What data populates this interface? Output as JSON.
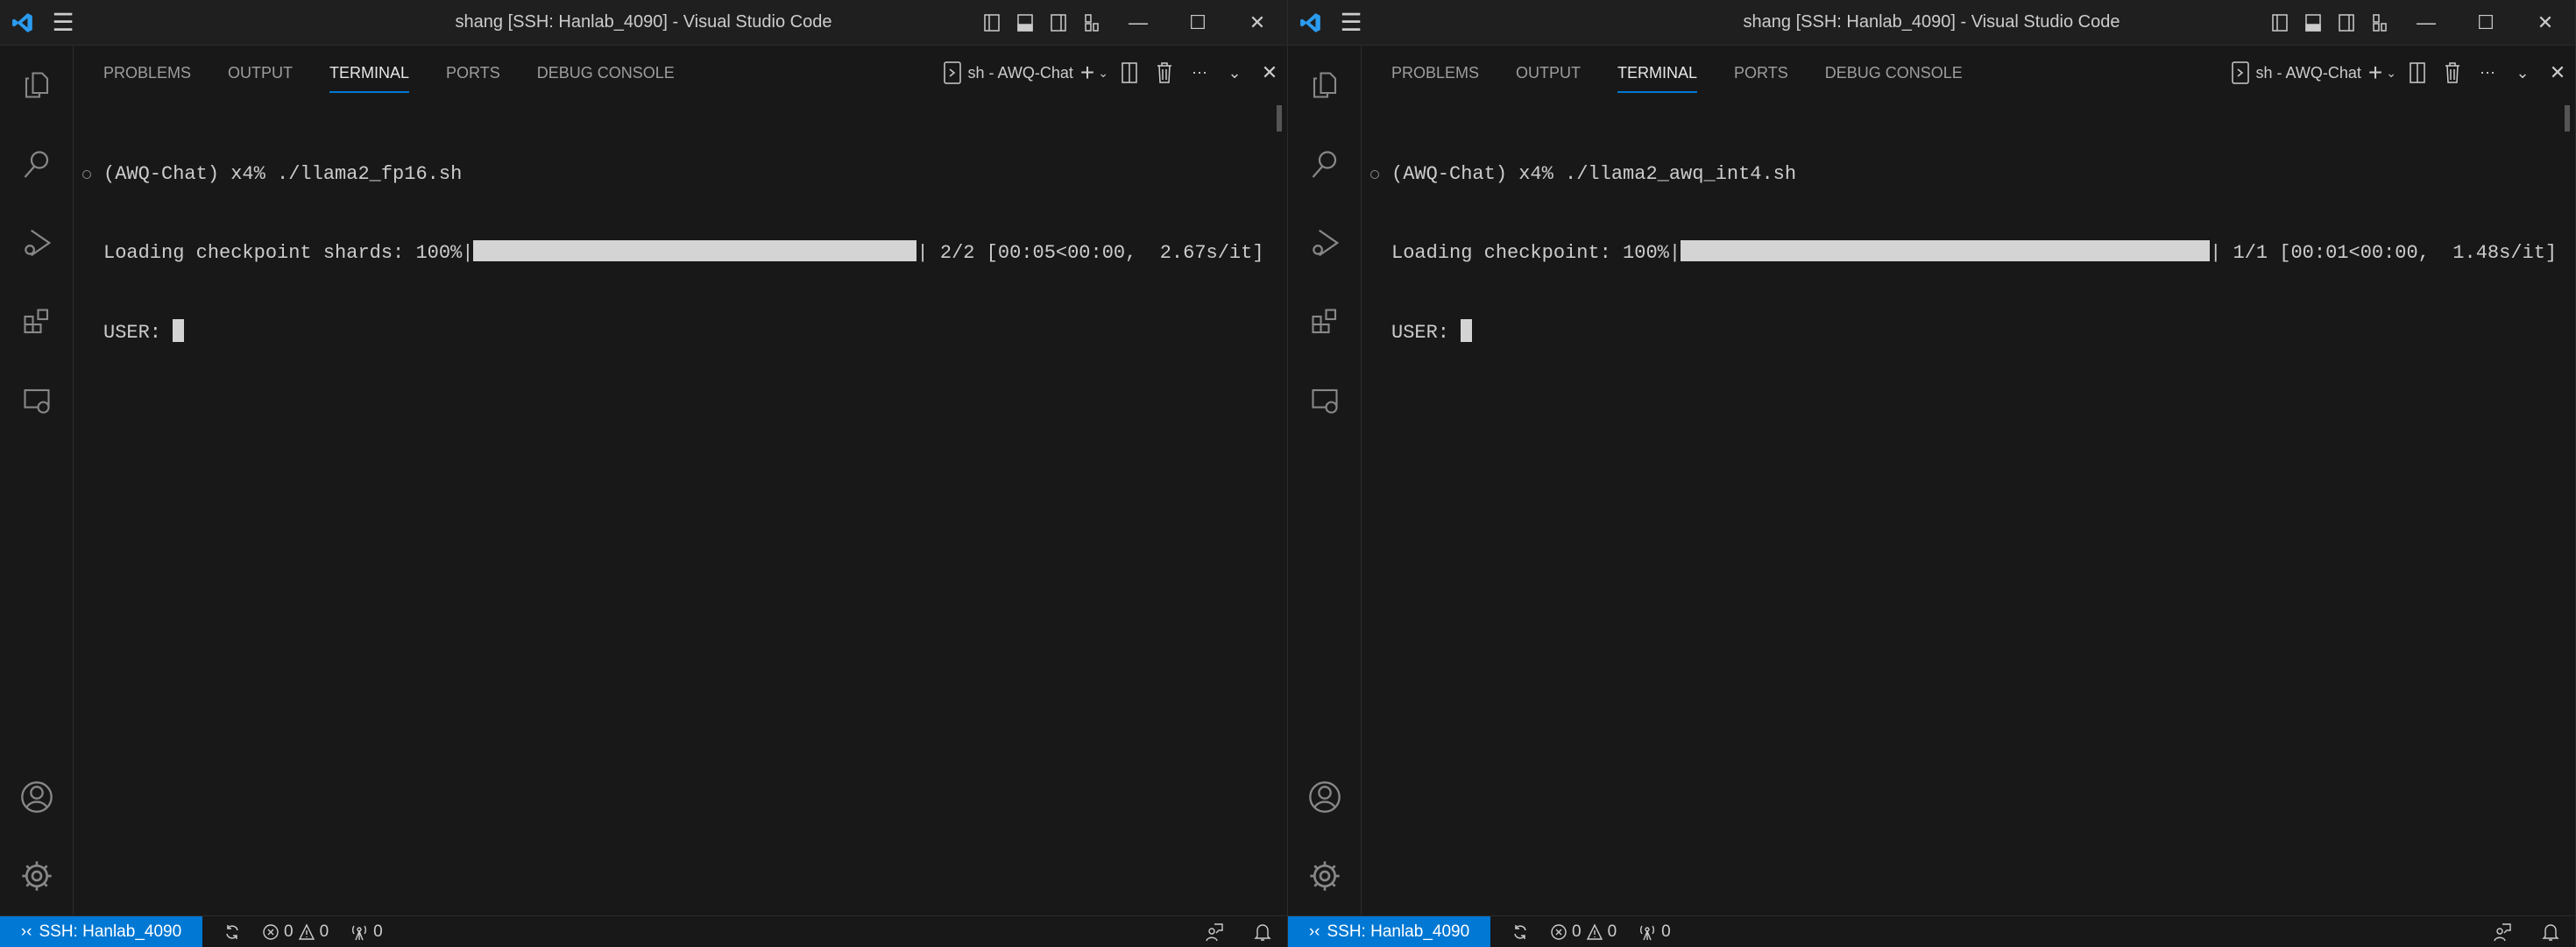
{
  "windows": [
    {
      "title": "shang [SSH: Hanlab_4090] - Visual Studio Code",
      "tabs": [
        "PROBLEMS",
        "OUTPUT",
        "TERMINAL",
        "PORTS",
        "DEBUG CONSOLE"
      ],
      "active_tab": "TERMINAL",
      "terminal_name": "sh - AWQ-Chat",
      "terminal": {
        "command": "(AWQ-Chat) x4% ./llama2_fp16.sh",
        "progress_prefix": "Loading checkpoint shards: 100%|",
        "progress_percent": 100,
        "progress_suffix": "| 2/2 [00:05<00:00,  2.67s/it]",
        "prompt": "USER: "
      },
      "status": {
        "remote": "SSH: Hanlab_4090",
        "errors": "0",
        "warnings": "0",
        "ports": "0"
      }
    },
    {
      "title": "shang [SSH: Hanlab_4090] - Visual Studio Code",
      "tabs": [
        "PROBLEMS",
        "OUTPUT",
        "TERMINAL",
        "PORTS",
        "DEBUG CONSOLE"
      ],
      "active_tab": "TERMINAL",
      "terminal_name": "sh - AWQ-Chat",
      "terminal": {
        "command": "(AWQ-Chat) x4% ./llama2_awq_int4.sh",
        "progress_prefix": "Loading checkpoint: 100%|",
        "progress_percent": 100,
        "progress_suffix": "| 1/1 [00:01<00:00,  1.48s/it]",
        "prompt": "USER: "
      },
      "status": {
        "remote": "SSH: Hanlab_4090",
        "errors": "0",
        "warnings": "0",
        "ports": "0"
      }
    }
  ],
  "colors": {
    "accent": "#0078d4",
    "background": "#181818",
    "titlebar": "#1f1f1f"
  }
}
